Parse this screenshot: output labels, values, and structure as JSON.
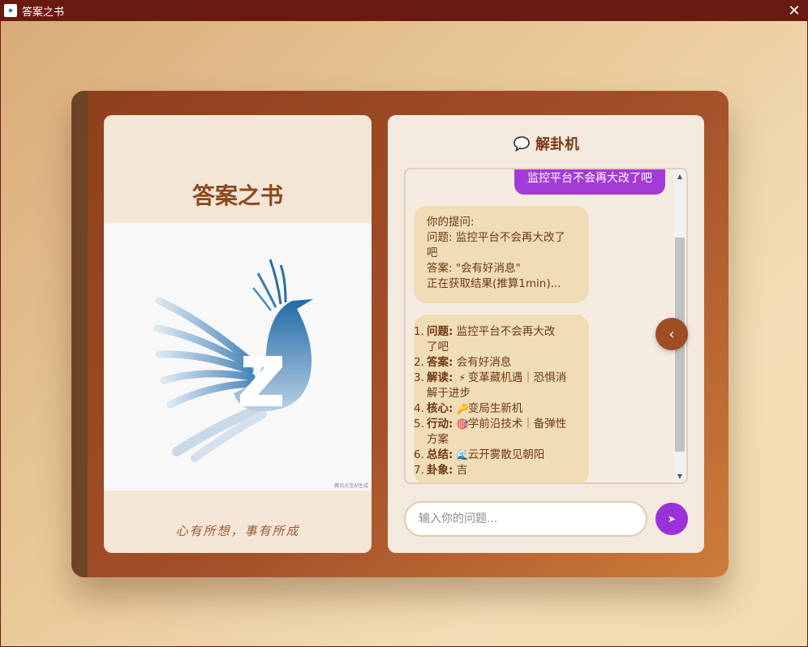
{
  "window": {
    "title": "答案之书",
    "close_glyph": "✕"
  },
  "left_page": {
    "title": "答案之书",
    "image_watermark": "腾讯元宝AI生成",
    "motto": "心有所想，事有所成"
  },
  "right_page": {
    "header_icon": "speech-bubble-icon",
    "title": "解卦机",
    "messages": {
      "user_question": "监控平台不会再大改了吧",
      "status": {
        "line1": "你的提问:",
        "line2": "问题: 监控平台不会再大改了",
        "line3": "吧",
        "line4": "答案: \"会有好消息\"",
        "line5": "正在获取结果(推算1min)..."
      },
      "result": {
        "items": [
          {
            "num": "1.",
            "label": "问题:",
            "text_a": "  监控平台不会再大改",
            "text_b": "了吧"
          },
          {
            "num": "2.",
            "label": "答案:",
            "text_a": "  会有好消息"
          },
          {
            "num": "3.",
            "label": "解读:",
            "emoji": "⚡",
            "text_a": "变革藏机遇｜恐惧消",
            "text_b": "解于进步"
          },
          {
            "num": "4.",
            "label": "核心:",
            "emoji": "🔑",
            "text_a": "变局生新机"
          },
          {
            "num": "5.",
            "label": "行动:",
            "emoji": "🎯",
            "text_a": "学前沿技术｜备弹性",
            "text_b": "方案"
          },
          {
            "num": "6.",
            "label": "总结:",
            "emoji": "🌊",
            "text_a": "云开雾散见朝阳"
          },
          {
            "num": "7.",
            "label": "卦象:",
            "text_a": "吉"
          }
        ]
      }
    },
    "collapse_glyph": "‹",
    "input": {
      "placeholder": "输入你的问题...",
      "value": ""
    },
    "send_glyph": "➤"
  },
  "colors": {
    "titlebar": "#6b1a12",
    "book_cover": "#a3502a",
    "user_bubble": "#a43bd6",
    "bot_bubble": "#f0dcb6",
    "send_button": "#9b32d9",
    "bird_blue": "#2a6ea8"
  }
}
